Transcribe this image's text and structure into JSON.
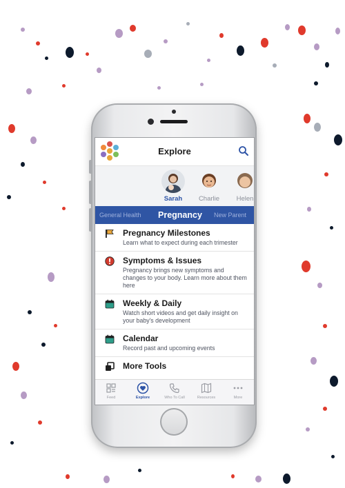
{
  "header": {
    "title": "Explore",
    "logo_icon": "family-logo-icon",
    "search_icon": "search-icon"
  },
  "profiles": [
    {
      "name": "Sarah",
      "selected": true
    },
    {
      "name": "Charlie",
      "selected": false
    },
    {
      "name": "Helen",
      "selected": false
    }
  ],
  "tabs": [
    {
      "label": "General Health",
      "active": false
    },
    {
      "label": "Pregnancy",
      "active": true
    },
    {
      "label": "New Parent",
      "active": false
    }
  ],
  "items": [
    {
      "title": "Pregnancy Milestones",
      "desc": "Learn what to expect during each trimester",
      "icon": "flag-icon"
    },
    {
      "title": "Symptoms & Issues",
      "desc": "Pregnancy brings new symptoms and changes to your body. Learn more about them here",
      "icon": "alert-icon"
    },
    {
      "title": "Weekly & Daily",
      "desc": "Watch short videos and get daily insight on your baby's development",
      "icon": "calendar-icon"
    },
    {
      "title": "Calendar",
      "desc": "Record past and upcoming events",
      "icon": "calendar-icon"
    },
    {
      "title": "More Tools",
      "desc": "",
      "icon": "tools-icon"
    }
  ],
  "bottom_nav": [
    {
      "label": "Feed",
      "icon": "feed-icon",
      "active": false
    },
    {
      "label": "Explore",
      "icon": "explore-heart-icon",
      "active": true
    },
    {
      "label": "Who To Call",
      "icon": "phone-icon",
      "active": false
    },
    {
      "label": "Resources",
      "icon": "map-icon",
      "active": false
    },
    {
      "label": "More",
      "icon": "more-dots-icon",
      "active": false
    }
  ],
  "colors": {
    "brand_blue": "#2f55a4",
    "confetti": [
      "#e03a2c",
      "#0d1a2c",
      "#b69bc4",
      "#a7adb7",
      "#7e8896"
    ]
  }
}
